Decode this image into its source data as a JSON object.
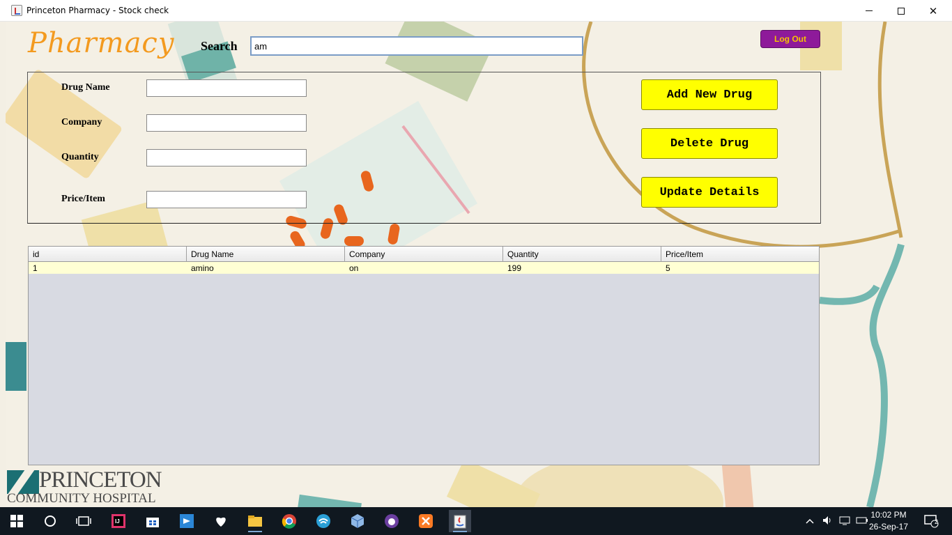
{
  "window": {
    "title": "Princeton Pharmacy - Stock check",
    "minimize_glyph": "—",
    "maximize_glyph": "☐",
    "close_glyph": "✕"
  },
  "header": {
    "logo_text": "Pharmacy",
    "search_label": "Search",
    "search_value": "am",
    "logout_label": "Log Out"
  },
  "form": {
    "fields": [
      {
        "label": "Drug Name",
        "value": ""
      },
      {
        "label": "Company",
        "value": ""
      },
      {
        "label": "Quantity",
        "value": ""
      },
      {
        "label": "Price/Item",
        "value": ""
      }
    ],
    "buttons": {
      "add": "Add New Drug",
      "delete": "Delete Drug",
      "update": "Update Details"
    }
  },
  "table": {
    "columns": [
      "id",
      "Drug Name",
      "Company",
      "Quantity",
      "Price/Item"
    ],
    "rows": [
      [
        "1",
        "amino",
        "on",
        "199",
        "5"
      ]
    ]
  },
  "footer_logo": {
    "line1": "PRINCETON",
    "line2": "COMMUNITY HOSPITAL"
  },
  "taskbar": {
    "icons": [
      "windows-start-icon",
      "cortana-icon",
      "task-view-icon",
      "intellij-icon",
      "store-icon",
      "video-editor-icon",
      "iheart-icon",
      "file-explorer-icon",
      "chrome-icon",
      "network-app-icon",
      "virtualbox-icon",
      "app-cat-icon",
      "xampp-icon",
      "java-icon"
    ],
    "clock_time": "10:02 PM",
    "clock_date": "26-Sep-17",
    "notification_count": "2"
  },
  "colors": {
    "accent_logo": "#f39a1f",
    "button_yellow": "#ffff00",
    "logout_purple": "#8e1a9a",
    "row_highlight": "#ffffd4"
  }
}
